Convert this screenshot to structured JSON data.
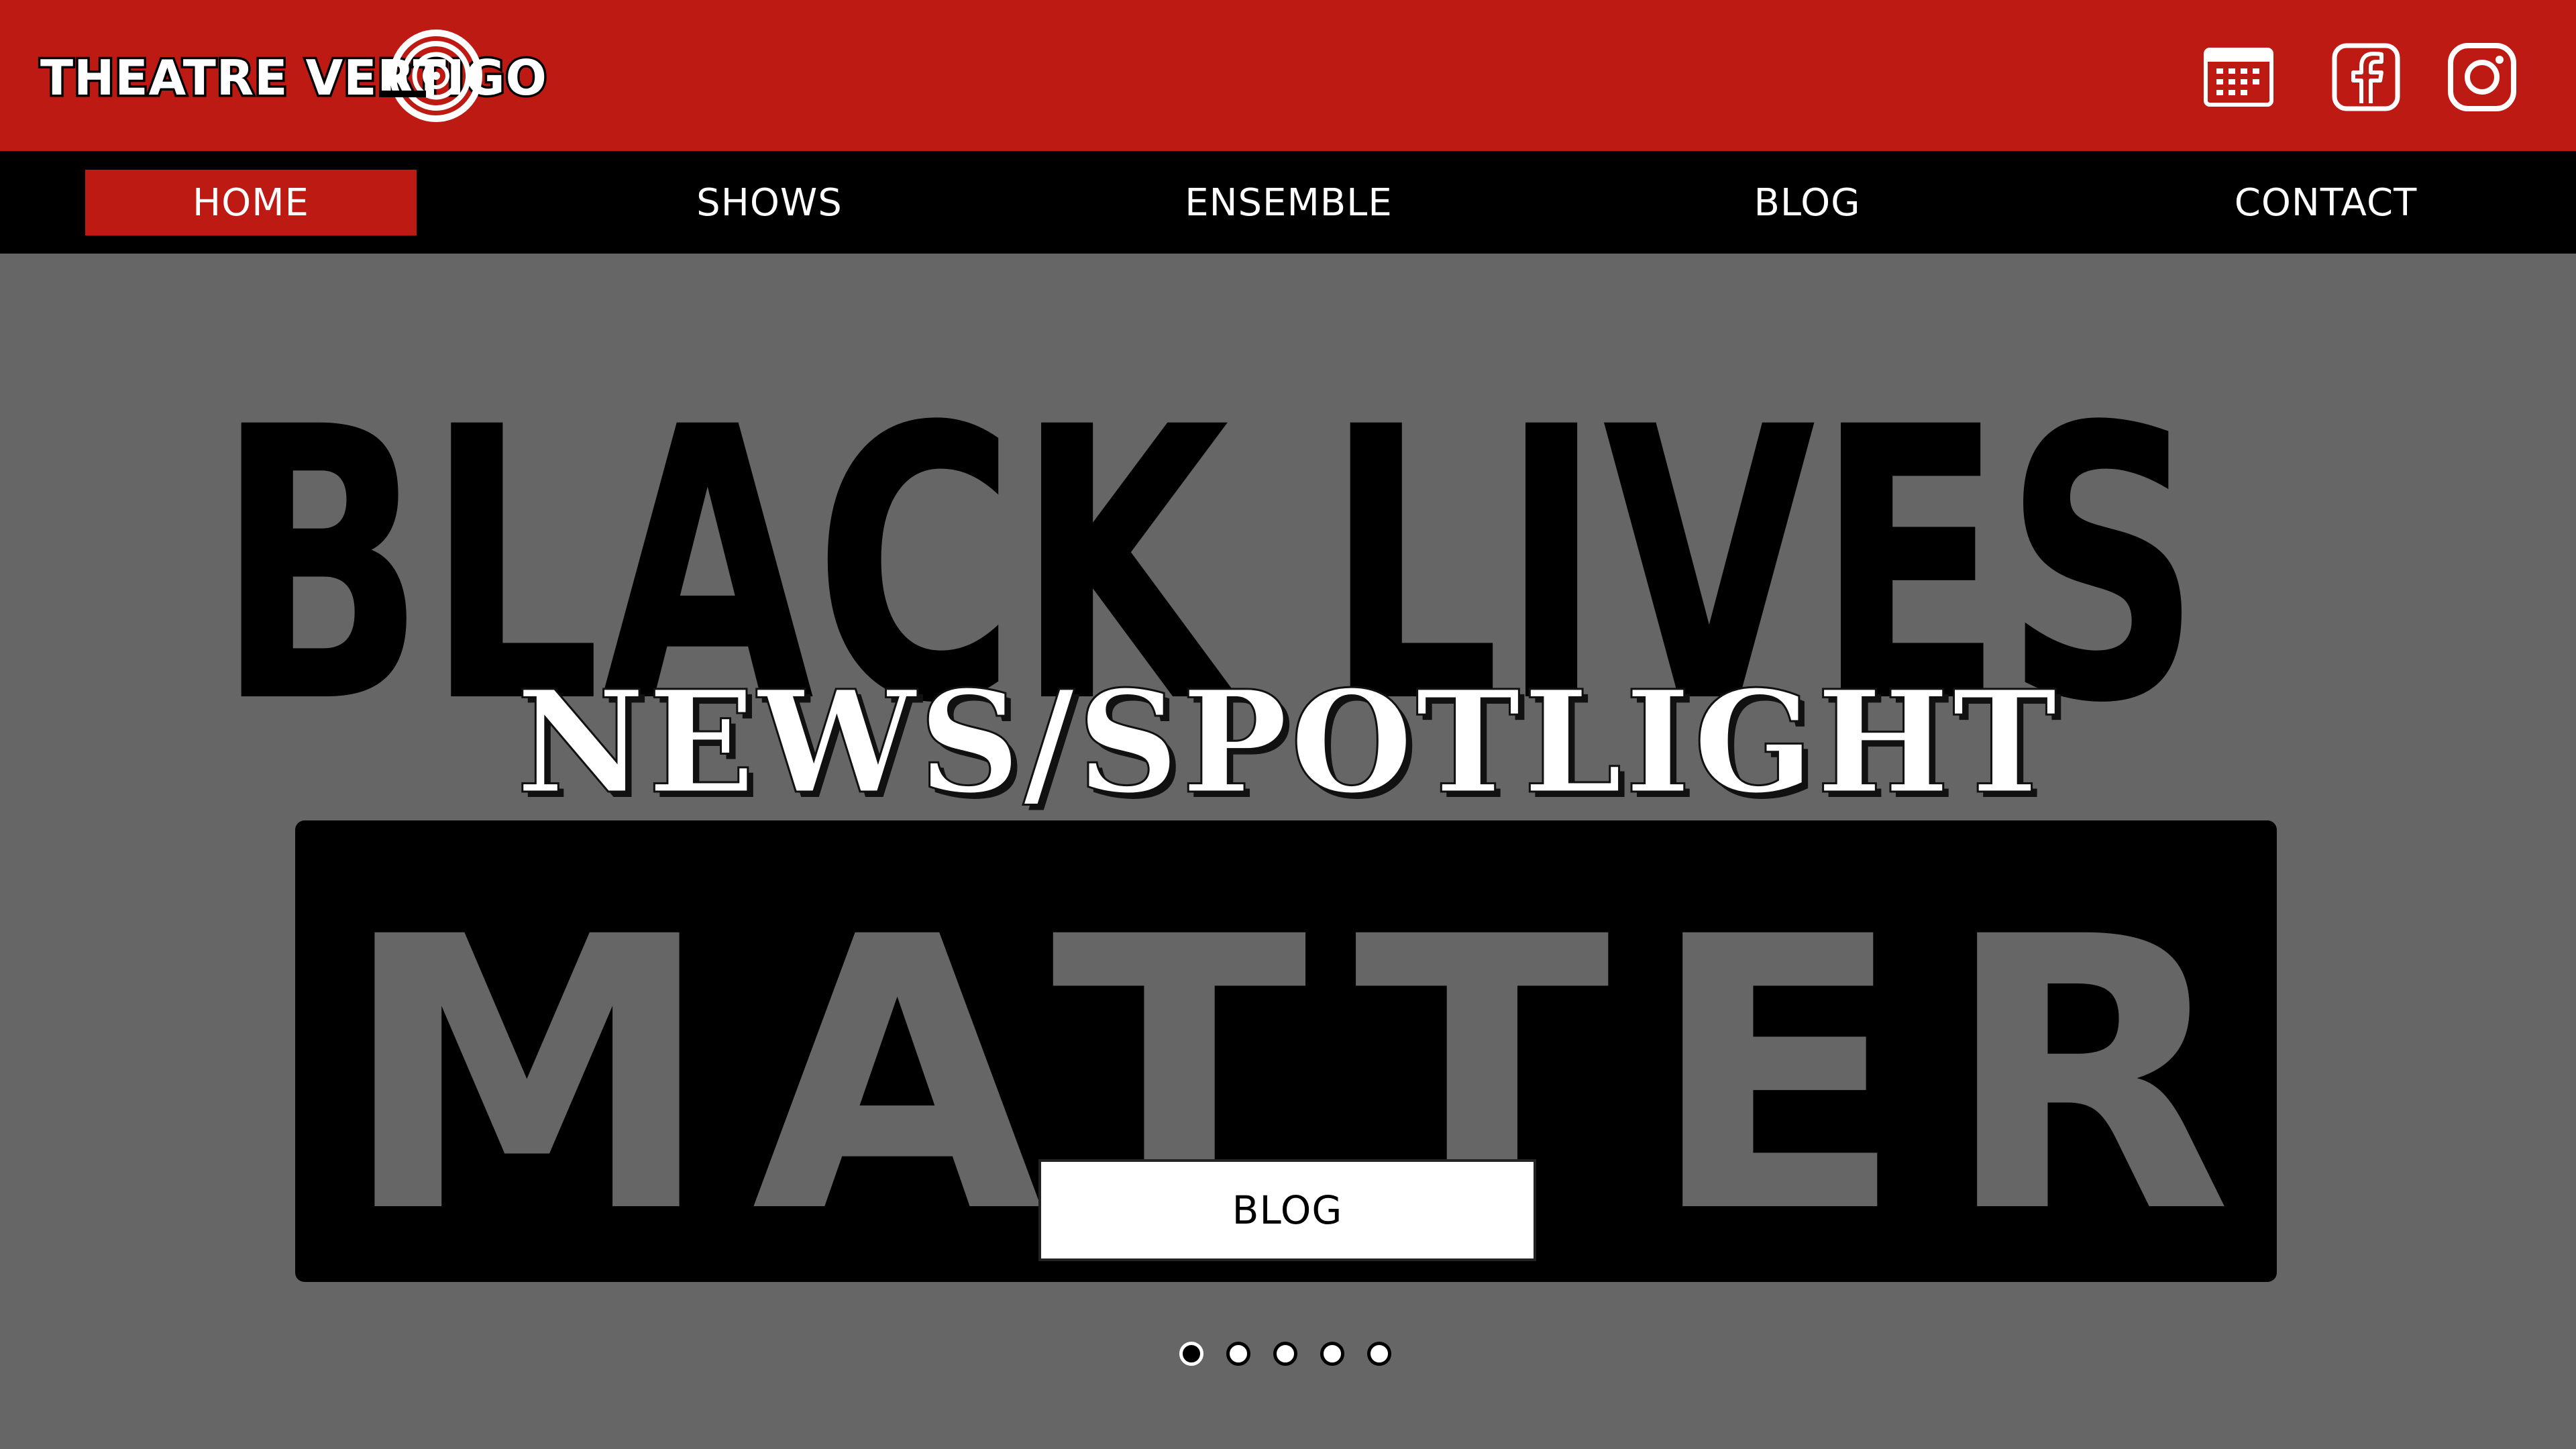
{
  "header": {
    "logo_text": "THEATRE VERTIGO",
    "social": [
      {
        "name": "calendar",
        "icon": "calendar-icon"
      },
      {
        "name": "facebook",
        "icon": "facebook-icon"
      },
      {
        "name": "instagram",
        "icon": "instagram-icon"
      }
    ]
  },
  "nav": {
    "items": [
      {
        "label": "HOME",
        "active": true
      },
      {
        "label": "SHOWS",
        "active": false
      },
      {
        "label": "ENSEMBLE",
        "active": false
      },
      {
        "label": "BLOG",
        "active": false
      },
      {
        "label": "CONTACT",
        "active": false
      }
    ]
  },
  "hero": {
    "background_text_line1": "BLACK LIVES",
    "background_text_line2": "MATTER",
    "headline": "NEWS/SPOTLIGHT",
    "cta_label": "BLOG",
    "slides_total": 5,
    "slide_active": 1
  },
  "colors": {
    "brand_red": "#be1a14",
    "nav_black": "#000000",
    "hero_gray": "#666666",
    "white": "#ffffff"
  }
}
